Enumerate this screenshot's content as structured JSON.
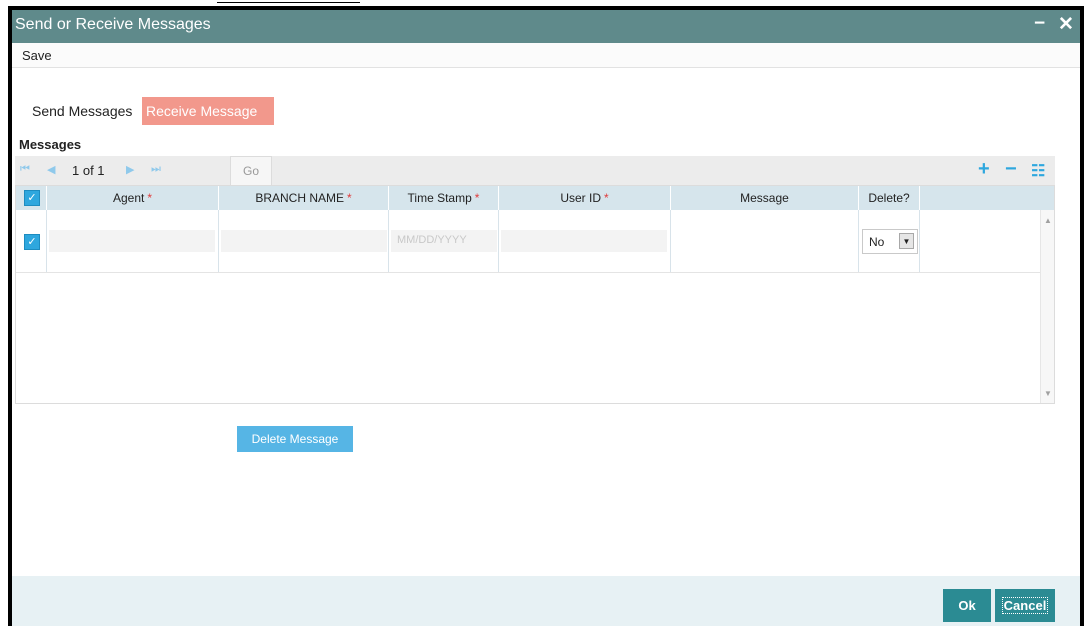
{
  "window": {
    "title": "Send or Receive Messages",
    "minimize_icon": "−",
    "close_icon": "✕"
  },
  "menu": {
    "save_label": "Save"
  },
  "tabs": [
    {
      "label": "Send Messages",
      "active": false
    },
    {
      "label": "Receive Message",
      "active": true
    }
  ],
  "section": {
    "title": "Messages"
  },
  "toolbar": {
    "pager_text": "1 of 1",
    "go_label": "Go",
    "icons": {
      "first": "⏮",
      "prev": "◀",
      "next": "▶",
      "last": "⏭",
      "add": "+",
      "remove": "−",
      "list": "☷"
    }
  },
  "table": {
    "columns": [
      {
        "label": "Agent",
        "required": true
      },
      {
        "label": "BRANCH NAME",
        "required": true
      },
      {
        "label": "Time Stamp",
        "required": true
      },
      {
        "label": "User ID",
        "required": true
      },
      {
        "label": "Message",
        "required": false
      },
      {
        "label": "Delete?",
        "required": false
      }
    ],
    "required_marker": "*",
    "rows": [
      {
        "selected": true,
        "agent": "",
        "branch_name": "",
        "time_stamp_placeholder": "MM/DD/YYYY",
        "user_id": "",
        "message": "",
        "delete_value": "No"
      }
    ],
    "header_checked": true,
    "check_glyph": "✓",
    "select_arrow": "▼"
  },
  "actions": {
    "delete_message_label": "Delete Message"
  },
  "footer": {
    "ok_label": "Ok",
    "cancel_label": "Cancel"
  },
  "colors": {
    "titlebar": "#5f8a8b",
    "active_tab": "#f2988c",
    "accent": "#2ea7de",
    "footer_button": "#2b8b93"
  }
}
